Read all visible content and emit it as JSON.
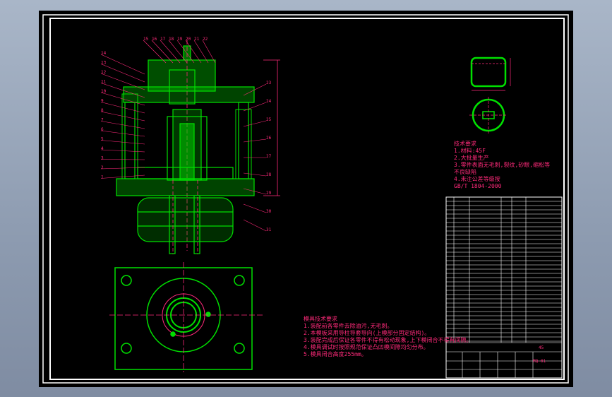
{
  "drawing": {
    "bg_color": "#000000",
    "part_color": "#00e000",
    "annotation_color": "#ff2a7a",
    "frame_color": "#ffffff",
    "balloons_top": [
      "15",
      "16",
      "17",
      "18",
      "19",
      "20",
      "21",
      "22"
    ],
    "balloons_left": [
      "14",
      "13",
      "12",
      "11",
      "10",
      "9",
      "8",
      "7",
      "6",
      "5",
      "4",
      "3",
      "2",
      "1"
    ],
    "balloons_right": [
      "23",
      "24",
      "25",
      "26",
      "27",
      "28",
      "29",
      "30",
      "31"
    ]
  },
  "part_notes": {
    "heading": "技术要求",
    "lines": [
      "1.材料:45F",
      "2.大批量生产",
      "3.零件表面无毛刺,裂纹,砂眼,缩松等",
      "  不良缺陷",
      "4.未注公差等级按",
      "  GB/T 1804-2000"
    ]
  },
  "assembly_notes": {
    "heading": "模具技术要求",
    "lines": [
      "1.装配前各零件去除油污,无毛刺。",
      "2.本模板采用导柱导套导向(上模部分固定结构)。",
      "3.装配完成后保证各零件不得有松动现象,上下模闭合不得有间隙。",
      "4.模具调试时按照规范保证凸凹模间隙均匀分布。",
      "5.模具闭合高度255mm。"
    ]
  },
  "title_block": {
    "material": "45",
    "drawing_no": "MQ-01"
  }
}
